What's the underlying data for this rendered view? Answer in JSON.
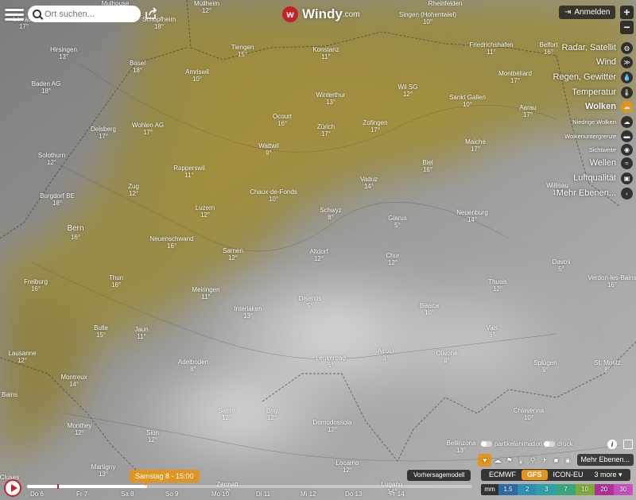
{
  "search": {
    "placeholder": "Ort suchen..."
  },
  "logo": {
    "word": "Windy",
    "domain": ".com"
  },
  "login": {
    "label": "Anmelden"
  },
  "zoom": {
    "in": "+",
    "out": "−"
  },
  "places": [
    {
      "name": "Mulhouse",
      "temp": "18°"
    },
    {
      "name": "Müllheim",
      "temp": "12°"
    },
    {
      "name": "Rheinfelden",
      "temp": ""
    },
    {
      "name": "Singen (Hohentwiel)",
      "temp": "10°"
    },
    {
      "name": "Lörrach",
      "temp": "17°"
    },
    {
      "name": "Schopfheim",
      "temp": "18°"
    },
    {
      "name": "Tiengen",
      "temp": "15°"
    },
    {
      "name": "Konstanz",
      "temp": "11°"
    },
    {
      "name": "Friedrichshafen",
      "temp": "11°"
    },
    {
      "name": "Belfort",
      "temp": "16°"
    },
    {
      "name": "Hirsingen",
      "temp": "13°"
    },
    {
      "name": "Basel",
      "temp": "18°"
    },
    {
      "name": "Amriswil",
      "temp": "10°"
    },
    {
      "name": "Montbéliard",
      "temp": "17°"
    },
    {
      "name": "Baden AG",
      "temp": "18°"
    },
    {
      "name": "Winterthur",
      "temp": "13°"
    },
    {
      "name": "Wil SG",
      "temp": "12°"
    },
    {
      "name": "Sankt Gallen",
      "temp": "10°"
    },
    {
      "name": "Aarau",
      "temp": "17°"
    },
    {
      "name": "Ocourt",
      "temp": "16°"
    },
    {
      "name": "Delsberg",
      "temp": "17°"
    },
    {
      "name": "Wohlen AG",
      "temp": "17°"
    },
    {
      "name": "Zürich",
      "temp": "17°"
    },
    {
      "name": "Zofingen",
      "temp": "17°"
    },
    {
      "name": "Wattwil",
      "temp": "9°"
    },
    {
      "name": "Maiche",
      "temp": "17°"
    },
    {
      "name": "Solothurn",
      "temp": "12°"
    },
    {
      "name": "Rapperswil",
      "temp": "11°"
    },
    {
      "name": "Biel",
      "temp": "16°"
    },
    {
      "name": "Zug",
      "temp": "12°"
    },
    {
      "name": "Vaduz",
      "temp": "14°"
    },
    {
      "name": "Willisau",
      "temp": "17°"
    },
    {
      "name": "Chaux-de-Fonds",
      "temp": "10°"
    },
    {
      "name": "Burgdorf BE",
      "temp": "18°"
    },
    {
      "name": "Luzern",
      "temp": "12°"
    },
    {
      "name": "Schwyz",
      "temp": "8°"
    },
    {
      "name": "Glarus",
      "temp": "5°"
    },
    {
      "name": "Neuenburg",
      "temp": "14°"
    },
    {
      "name": "Bern",
      "temp": "16°"
    },
    {
      "name": "Neuenschwand",
      "temp": "16°"
    },
    {
      "name": "Sarnen",
      "temp": "12°"
    },
    {
      "name": "Altdorf",
      "temp": "12°"
    },
    {
      "name": "Chur",
      "temp": "12°"
    },
    {
      "name": "Davos",
      "temp": "5°"
    },
    {
      "name": "Verdon-les-Bains",
      "temp": "16°"
    },
    {
      "name": "Freiburg",
      "temp": "16°"
    },
    {
      "name": "Thun",
      "temp": "16°"
    },
    {
      "name": "Meiringen",
      "temp": "11°"
    },
    {
      "name": "Disentis",
      "temp": "5°"
    },
    {
      "name": "Thusis",
      "temp": "12°"
    },
    {
      "name": "Interlaken",
      "temp": "13°"
    },
    {
      "name": "Bulle",
      "temp": "15°"
    },
    {
      "name": "Jaun",
      "temp": "11°"
    },
    {
      "name": "Vals",
      "temp": "6°"
    },
    {
      "name": "Lausanne",
      "temp": "12°"
    },
    {
      "name": "Adelboden",
      "temp": "8°"
    },
    {
      "name": "Airolo",
      "temp": "3°"
    },
    {
      "name": "Olivone",
      "temp": "8°"
    },
    {
      "name": "Splügen",
      "temp": "9°"
    },
    {
      "name": "St. Moritz",
      "temp": "8°"
    },
    {
      "name": "Montreux",
      "temp": "14°"
    },
    {
      "name": "Leukerbad",
      "temp": "5°"
    },
    {
      "name": "Bains",
      "temp": ""
    },
    {
      "name": "Sierre",
      "temp": "12°"
    },
    {
      "name": "Brig",
      "temp": "12°"
    },
    {
      "name": "Biasca",
      "temp": "10°"
    },
    {
      "name": "Chiavenna",
      "temp": "10°"
    },
    {
      "name": "Monthey",
      "temp": "12°"
    },
    {
      "name": "Sion",
      "temp": "12°"
    },
    {
      "name": "Domodossola",
      "temp": "12°"
    },
    {
      "name": "Bellinzona",
      "temp": "13°"
    },
    {
      "name": "Martigny",
      "temp": "13°"
    },
    {
      "name": "Zermatt",
      "temp": "3°"
    },
    {
      "name": "Locarno",
      "temp": "12°"
    },
    {
      "name": "Lugano",
      "temp": "14°"
    },
    {
      "name": "Cluses",
      "temp": ""
    }
  ],
  "layers": [
    {
      "label": "Radar, Satellit",
      "icon": "satellite-icon"
    },
    {
      "label": "Wind",
      "icon": "wind-icon"
    },
    {
      "label": "Regen, Gewitter",
      "icon": "rain-icon"
    },
    {
      "label": "Temperatur",
      "icon": "thermometer-icon"
    },
    {
      "label": "Wolken",
      "icon": "cloud-icon",
      "active": true
    },
    {
      "label": "Niedrige Wolken",
      "icon": "low-cloud-icon",
      "sub": true
    },
    {
      "label": "Wolkenuntergrenze",
      "icon": "cloud-base-icon",
      "sub": true
    },
    {
      "label": "Sichtweite",
      "icon": "eye-icon",
      "sub": true
    },
    {
      "label": "Wellen",
      "icon": "waves-icon"
    },
    {
      "label": "Luftqualität",
      "icon": "car-icon"
    },
    {
      "label": "Mehr Ebenen...",
      "icon": "chevron-left-icon"
    }
  ],
  "toggles": {
    "particles": "partikelanimation",
    "pressure": "druck"
  },
  "overlay": {
    "more": "Mehr Ebenen..."
  },
  "models": {
    "button": "Vorhersagemodell",
    "items": [
      {
        "label": "ECMWF"
      },
      {
        "label": "GFS",
        "active": true
      },
      {
        "label": "ICON-EU"
      },
      {
        "label": "3 more ▾"
      }
    ]
  },
  "legend": {
    "unit": "mm",
    "steps": [
      {
        "label": "1.5",
        "color": "#2f6aa6"
      },
      {
        "label": "2",
        "color": "#2d8fb3"
      },
      {
        "label": "3",
        "color": "#2ea0a6"
      },
      {
        "label": "7",
        "color": "#39a67a"
      },
      {
        "label": "10",
        "color": "#7faa3a"
      },
      {
        "label": "20",
        "color": "#b0319a"
      },
      {
        "label": "30",
        "color": "#c74fbd"
      }
    ]
  },
  "timeline": {
    "current": "Samstag 8 - 15:00",
    "progress": 0.27,
    "days": [
      "Do 6",
      "Fr 7",
      "Sa 8",
      "So 9",
      "Mo 10",
      "Di 11",
      "Mi 12",
      "Do 13",
      "Fr 14"
    ]
  },
  "colors": {
    "accent": "#e2951e",
    "brand": "#c4222a"
  }
}
